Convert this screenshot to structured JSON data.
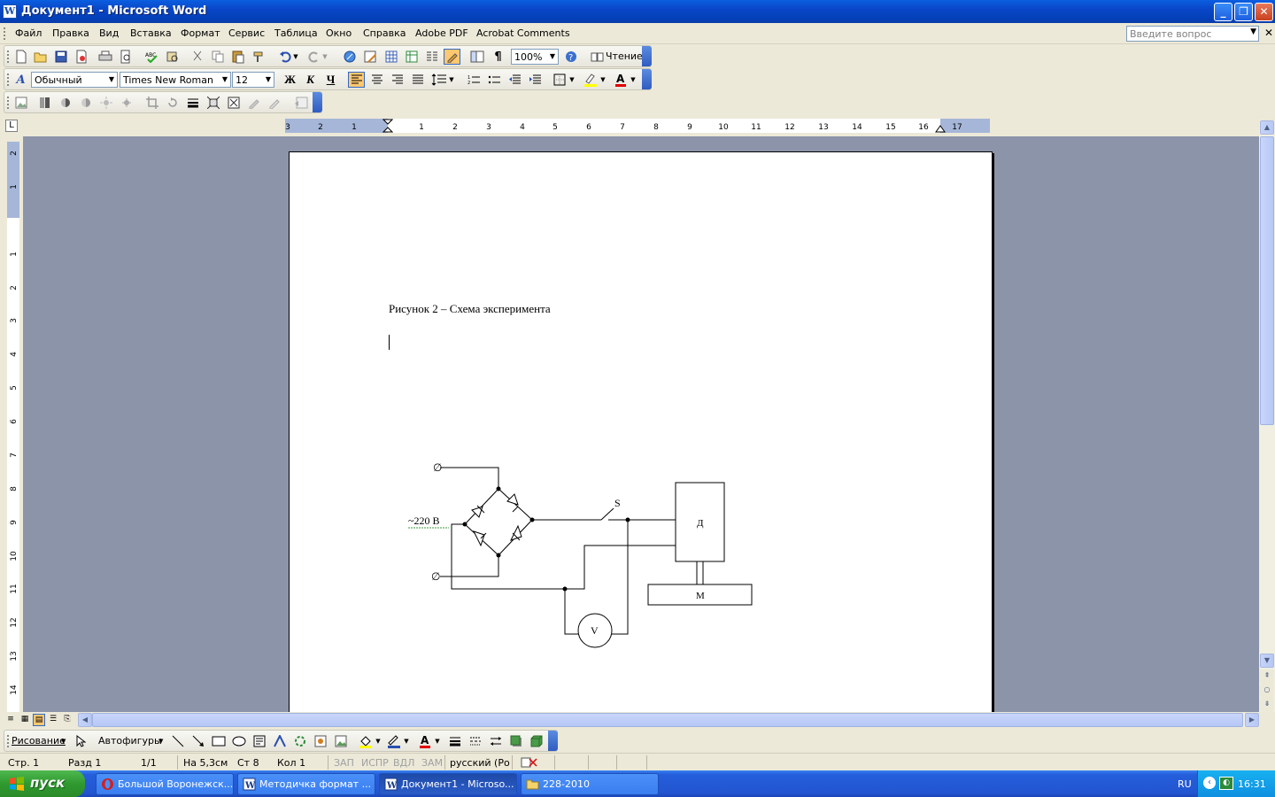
{
  "window": {
    "title": "Документ1 - Microsoft Word"
  },
  "menu": {
    "items": [
      "Файл",
      "Правка",
      "Вид",
      "Вставка",
      "Формат",
      "Сервис",
      "Таблица",
      "Окно",
      "Справка",
      "Adobe PDF",
      "Acrobat Comments"
    ],
    "help_placeholder": "Введите вопрос"
  },
  "standard_toolbar": {
    "zoom": "100%",
    "read_label": "Чтение"
  },
  "format_toolbar": {
    "style": "Обычный",
    "font": "Times New Roman",
    "size": "12",
    "bold_label": "Ж",
    "italic_label": "К",
    "underline_label": "Ч"
  },
  "ruler": {
    "labels": [
      "3",
      "2",
      "1",
      "1",
      "2",
      "3",
      "4",
      "5",
      "6",
      "7",
      "8",
      "9",
      "10",
      "11",
      "12",
      "13",
      "14",
      "15",
      "16",
      "17"
    ],
    "vlabels": [
      "2",
      "1",
      "1",
      "2",
      "3",
      "4",
      "5",
      "6",
      "7",
      "8",
      "9",
      "10",
      "11",
      "12",
      "13",
      "14"
    ]
  },
  "document": {
    "caption": "Рисунок 2 – Схема эксперимента",
    "diagram": {
      "source_label": "~220 В",
      "switch_label": "S",
      "motor_label": "Д",
      "brake_label": "М",
      "voltmeter_label": "V",
      "terminal_symbol": "∅"
    }
  },
  "drawing_toolbar": {
    "draw_label": "Рисование",
    "autoshapes_label": "Автофигуры"
  },
  "status": {
    "page": "Стр. 1",
    "section": "Разд 1",
    "pages": "1/1",
    "position": "На 5,3см",
    "line": "Ст 8",
    "column": "Кол 1",
    "rec": "ЗАП",
    "trk": "ИСПР",
    "ext": "ВДЛ",
    "ovr": "ЗАМ",
    "language": "русский (Ро"
  },
  "taskbar": {
    "start_label": "пуск",
    "tasks": [
      "Большой Воронежск...",
      "Методичка формат ...",
      "Документ1 - Microso...",
      "228-2010"
    ],
    "language": "RU",
    "time": "16:31"
  },
  "colors": {
    "titlebar": "#0a5fe0",
    "accent_highlight": "#ffc870",
    "page_bg": "#ffffff",
    "workspace": "#8c94aa"
  }
}
